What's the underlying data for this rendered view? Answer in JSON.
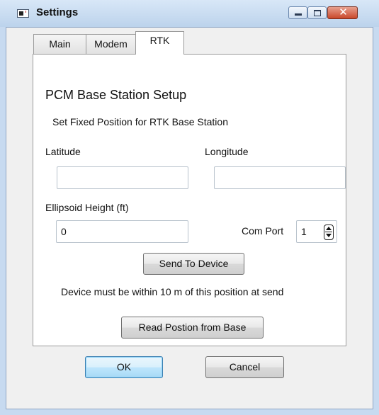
{
  "window": {
    "title": "Settings",
    "close_glyph": "✕"
  },
  "tabs": [
    {
      "label": "Main"
    },
    {
      "label": "Modem"
    },
    {
      "label": "RTK"
    }
  ],
  "rtk_panel": {
    "heading": "PCM Base Station Setup",
    "subheading": "Set Fixed Position for RTK Base Station",
    "latitude_label": "Latitude",
    "latitude_value": "",
    "longitude_label": "Longitude",
    "longitude_value": "",
    "ellipsoid_label": "Ellipsoid Height (ft)",
    "ellipsoid_value": "0",
    "com_port_label": "Com Port",
    "com_port_value": "1",
    "send_button": "Send To Device",
    "note": "Device must be within 10 m of this position at send",
    "read_button": "Read Postion from Base"
  },
  "dialog_buttons": {
    "ok": "OK",
    "cancel": "Cancel"
  },
  "icons": [
    "app-icon",
    "minimize-icon",
    "maximize-icon",
    "close-icon",
    "spinner-arrows-icon"
  ]
}
